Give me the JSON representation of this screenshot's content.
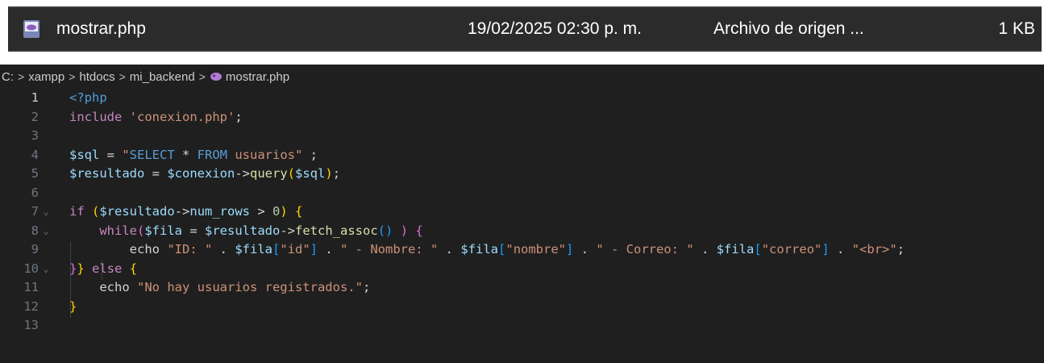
{
  "file_row": {
    "name": "mostrar.php",
    "date": "19/02/2025 02:30 p. m.",
    "type": "Archivo de origen ...",
    "size": "1 KB",
    "icon": "php-file-icon"
  },
  "breadcrumb": {
    "items": [
      "C:",
      "xampp",
      "htdocs",
      "mi_backend",
      "mostrar.php"
    ],
    "separator": ">"
  },
  "editor": {
    "line_numbers": [
      "1",
      "2",
      "3",
      "4",
      "5",
      "6",
      "7",
      "8",
      "9",
      "10",
      "11",
      "12",
      "13"
    ],
    "active_line": "1",
    "code": {
      "l1_open": "<?php",
      "l2_include": "include",
      "l2_str": "'conexion.php'",
      "l2_semi": ";",
      "l4_var": "$sql",
      "l4_eq": " = ",
      "l4_q1": "\"",
      "l4_select": "SELECT",
      "l4_star": " * ",
      "l4_from": "FROM",
      "l4_table": " usuarios\"",
      "l4_end": " ;",
      "l5_var": "$resultado",
      "l5_eq": " = ",
      "l5_conn": "$conexion",
      "l5_arrow": "->",
      "l5_fn": "query",
      "l5_p1": "(",
      "l5_arg": "$sql",
      "l5_p2": ")",
      "l5_semi": ";",
      "l7_if": "if",
      "l7_sp": " ",
      "l7_p1": "(",
      "l7_var": "$resultado",
      "l7_arrow": "->",
      "l7_prop": "num_rows",
      "l7_gt": " > ",
      "l7_num": "0",
      "l7_p2": ")",
      "l7_sp2": " ",
      "l7_b": "{",
      "l8_while": "while",
      "l8_p1": "(",
      "l8_var": "$fila",
      "l8_eq": " = ",
      "l8_res": "$resultado",
      "l8_arrow": "->",
      "l8_fn": "fetch_assoc",
      "l8_p2": "()",
      "l8_sp": " ",
      "l8_p3": ")",
      "l8_sp2": " ",
      "l8_b": "{",
      "l9_echo": "echo ",
      "l9_s1": "\"ID: \"",
      "l9_dot1": " . ",
      "l9_fila1": "$fila",
      "l9_b1o": "[",
      "l9_k1": "\"id\"",
      "l9_b1c": "]",
      "l9_dot2": " . ",
      "l9_s2": "\" - Nombre: \"",
      "l9_dot3": " . ",
      "l9_fila2": "$fila",
      "l9_b2o": "[",
      "l9_k2": "\"nombre\"",
      "l9_b2c": "]",
      "l9_dot4": " . ",
      "l9_s3": "\" - Correo: \"",
      "l9_dot5": " . ",
      "l9_fila3": "$fila",
      "l9_b3o": "[",
      "l9_k3": "\"correo\"",
      "l9_b3c": "]",
      "l9_dot6": " . ",
      "l9_s4": "\"<br>\"",
      "l9_semi": ";",
      "l10_b1": "}",
      "l10_b2": "}",
      "l10_else": " else ",
      "l10_b3": "{",
      "l11_echo": "echo ",
      "l11_str": "\"No hay usuarios registrados.\"",
      "l11_semi": ";",
      "l12_b": "}"
    }
  },
  "colors": {
    "editor_bg": "#1f1f1f",
    "file_row_bg": "#2b2b2b",
    "keyword": "#c586c0",
    "variable": "#9cdcfe",
    "string": "#ce9178",
    "function": "#dcdcaa"
  }
}
